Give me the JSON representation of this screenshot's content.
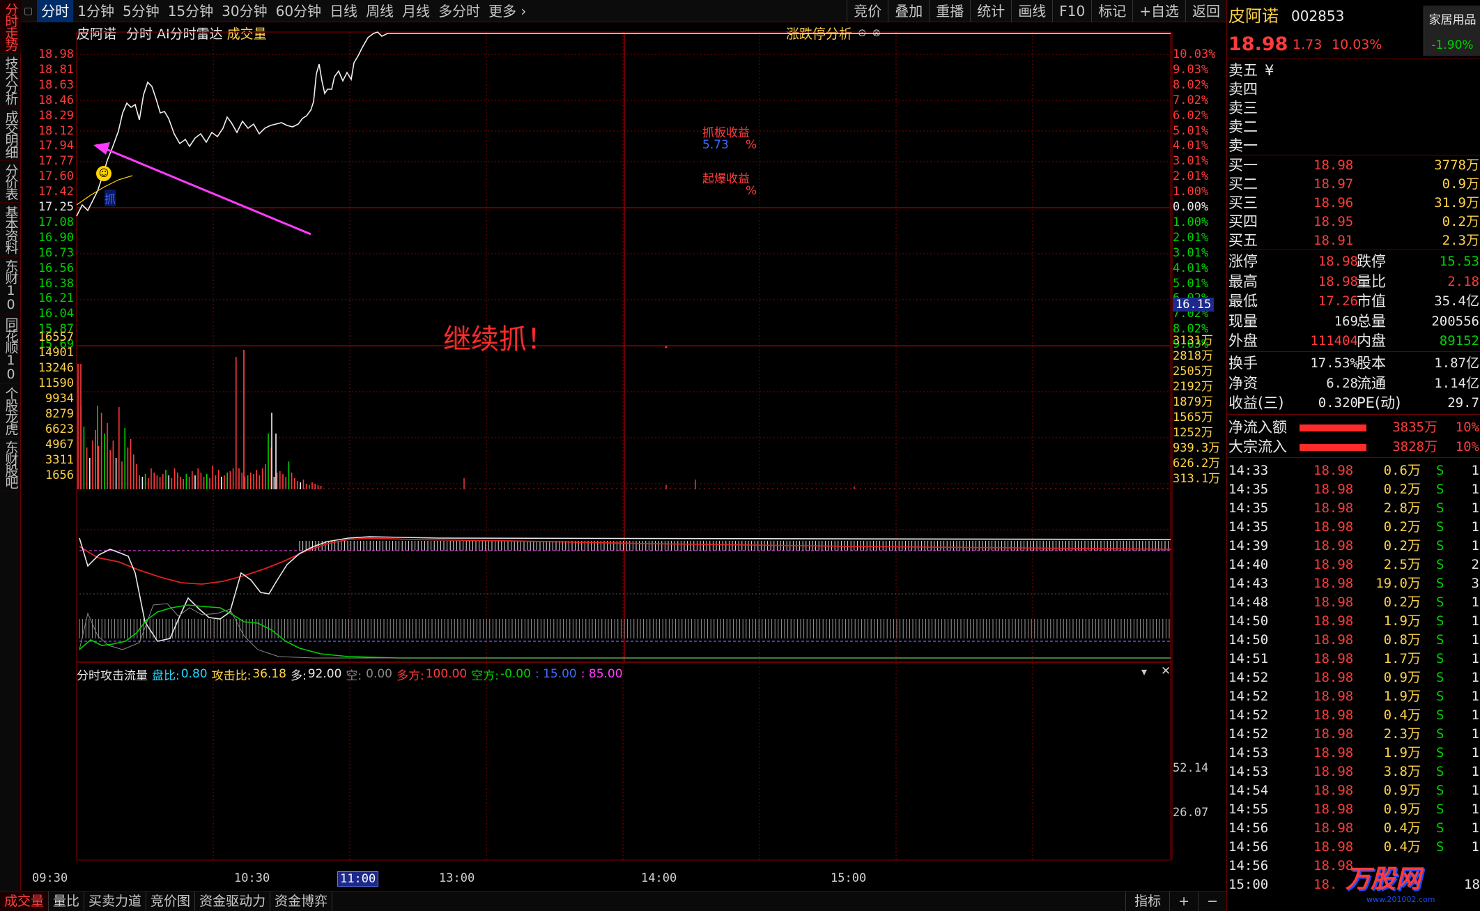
{
  "left_tabs": [
    "分时走势",
    "技术分析",
    "成交明细",
    "分价表",
    "基本资料",
    "东财10",
    "同花顺10",
    "个股龙虎",
    "东财股吧"
  ],
  "toolbar": {
    "left": [
      "分时",
      "1分钟",
      "5分钟",
      "15分钟",
      "30分钟",
      "60分钟",
      "日线",
      "周线",
      "月线",
      "多分时",
      "更多 ›"
    ],
    "right": [
      "竞价",
      "叠加",
      "重播",
      "统计",
      "画线",
      "F10",
      "标记",
      "+自选",
      "返回"
    ]
  },
  "info_bar": {
    "stock": "皮阿诺",
    "mode": "分时",
    "radar": "AI分时雷达",
    "volume": "成交量",
    "analysis": "涨跌停分析"
  },
  "price_axis_left": [
    "18.98",
    "18.81",
    "18.63",
    "18.46",
    "18.29",
    "18.12",
    "17.94",
    "17.77",
    "17.60",
    "17.42",
    "17.25",
    "17.08",
    "16.90",
    "16.73",
    "16.56",
    "16.38",
    "16.21",
    "16.04",
    "15.87",
    "15.69"
  ],
  "price_axis_right": [
    "10.03%",
    "9.03%",
    "8.02%",
    "7.02%",
    "6.02%",
    "5.01%",
    "4.01%",
    "3.01%",
    "2.01%",
    "1.00%",
    "0.00%",
    "1.00%",
    "2.01%",
    "3.01%",
    "4.01%",
    "5.01%",
    "6.02%",
    "7.02%",
    "8.02%",
    "9.03%"
  ],
  "price_axis_marker": "16.15",
  "volume_axis_left": [
    "16557",
    "14901",
    "13246",
    "11590",
    "9934",
    "8279",
    "6623",
    "4967",
    "3311",
    "1656"
  ],
  "volume_axis_right": [
    "3131万",
    "2818万",
    "2505万",
    "2192万",
    "1879万",
    "1565万",
    "1252万",
    "939.3万",
    "626.2万",
    "313.1万"
  ],
  "annotations": {
    "grab_profit": "抓板收益",
    "grab_value": "5.73",
    "grab_pct": "%",
    "blast_profit": "起爆收益",
    "blast_pct": "%",
    "grab_marker": "抓",
    "callout": "继续抓！"
  },
  "indicator": {
    "name": "分时攻击流量",
    "pan_label": "盘比:",
    "pan_value": "0.80",
    "attack_label": "攻击比:",
    "attack_value": "36.18",
    "duo_label": "多:",
    "duo_value": "92.00",
    "kong_label": "空:",
    "kong_value": "0.00",
    "duofang_label": "多方:",
    "duofang_value": "100.00",
    "kongfang_label": "空方:",
    "kongfang_value": "-0.00",
    "v15": ": 15.00",
    "v85": ": 85.00",
    "axis1": "52.14",
    "axis2": "26.07"
  },
  "time_axis": [
    "09:30",
    "10:30",
    "11:00",
    "13:00",
    "14:00",
    "15:00"
  ],
  "bottom_tabs": [
    "成交量",
    "量比",
    "买卖力道",
    "竞价图",
    "资金驱动力",
    "资金博弈"
  ],
  "bottom_right": [
    "指标",
    "+",
    "−"
  ],
  "panel": {
    "name": "皮阿诺",
    "code": "002853",
    "tag": "家居用品",
    "tag_change": "-1.90%",
    "price": "18.98",
    "change": "1.73",
    "change_pct": "10.03%",
    "asks": [
      {
        "label": "卖五",
        "price": "¥",
        "vol": ""
      },
      {
        "label": "卖四",
        "price": "",
        "vol": ""
      },
      {
        "label": "卖三",
        "price": "",
        "vol": ""
      },
      {
        "label": "卖二",
        "price": "",
        "vol": ""
      },
      {
        "label": "卖一",
        "price": "",
        "vol": ""
      }
    ],
    "bids": [
      {
        "label": "买一",
        "price": "18.98",
        "vol": "3778万"
      },
      {
        "label": "买二",
        "price": "18.97",
        "vol": "0.9万"
      },
      {
        "label": "买三",
        "price": "18.96",
        "vol": "31.9万"
      },
      {
        "label": "买四",
        "price": "18.95",
        "vol": "0.2万"
      },
      {
        "label": "买五",
        "price": "18.91",
        "vol": "2.3万"
      }
    ],
    "stats": [
      {
        "l1": "涨停",
        "v1": "18.98",
        "l2": "跌停",
        "v2": "15.53"
      },
      {
        "l1": "最高",
        "v1": "18.98",
        "l2": "量比",
        "v2": "2.18"
      },
      {
        "l1": "最低",
        "v1": "17.26",
        "l2": "市值",
        "v2": "35.4亿"
      },
      {
        "l1": "现量",
        "v1": "169",
        "l2": "总量",
        "v2": "200556"
      },
      {
        "l1": "外盘",
        "v1": "111404",
        "l2": "内盘",
        "v2": "89152"
      }
    ],
    "stats2": [
      {
        "l1": "换手",
        "v1": "17.53%",
        "l2": "股本",
        "v2": "1.87亿"
      },
      {
        "l1": "净资",
        "v1": "6.28",
        "l2": "流通",
        "v2": "1.14亿"
      },
      {
        "l1": "收益(三)",
        "v1": "0.320",
        "l2": "PE(动)",
        "v2": "29.7"
      }
    ],
    "flows": [
      {
        "label": "净流入额",
        "value": "3835万",
        "pct": "10%"
      },
      {
        "label": "大宗流入",
        "value": "3828万",
        "pct": "10%"
      }
    ],
    "ticks": [
      {
        "t": "14:33",
        "p": "18.98",
        "v": "0.6万",
        "s": "S",
        "n": "1"
      },
      {
        "t": "14:35",
        "p": "18.98",
        "v": "0.2万",
        "s": "S",
        "n": "1"
      },
      {
        "t": "14:35",
        "p": "18.98",
        "v": "2.8万",
        "s": "S",
        "n": "1"
      },
      {
        "t": "14:35",
        "p": "18.98",
        "v": "0.2万",
        "s": "S",
        "n": "1"
      },
      {
        "t": "14:39",
        "p": "18.98",
        "v": "0.2万",
        "s": "S",
        "n": "1"
      },
      {
        "t": "14:40",
        "p": "18.98",
        "v": "2.5万",
        "s": "S",
        "n": "2"
      },
      {
        "t": "14:43",
        "p": "18.98",
        "v": "19.0万",
        "s": "S",
        "n": "3"
      },
      {
        "t": "14:48",
        "p": "18.98",
        "v": "0.2万",
        "s": "S",
        "n": "1"
      },
      {
        "t": "14:50",
        "p": "18.98",
        "v": "1.9万",
        "s": "S",
        "n": "1"
      },
      {
        "t": "14:50",
        "p": "18.98",
        "v": "0.8万",
        "s": "S",
        "n": "1"
      },
      {
        "t": "14:51",
        "p": "18.98",
        "v": "1.7万",
        "s": "S",
        "n": "1"
      },
      {
        "t": "14:52",
        "p": "18.98",
        "v": "0.9万",
        "s": "S",
        "n": "1"
      },
      {
        "t": "14:52",
        "p": "18.98",
        "v": "1.9万",
        "s": "S",
        "n": "1"
      },
      {
        "t": "14:52",
        "p": "18.98",
        "v": "0.4万",
        "s": "S",
        "n": "1"
      },
      {
        "t": "14:52",
        "p": "18.98",
        "v": "2.3万",
        "s": "S",
        "n": "1"
      },
      {
        "t": "14:53",
        "p": "18.98",
        "v": "1.9万",
        "s": "S",
        "n": "1"
      },
      {
        "t": "14:53",
        "p": "18.98",
        "v": "3.8万",
        "s": "S",
        "n": "1"
      },
      {
        "t": "14:54",
        "p": "18.98",
        "v": "0.9万",
        "s": "S",
        "n": "1"
      },
      {
        "t": "14:55",
        "p": "18.98",
        "v": "0.9万",
        "s": "S",
        "n": "1"
      },
      {
        "t": "14:56",
        "p": "18.98",
        "v": "0.4万",
        "s": "S",
        "n": "1"
      },
      {
        "t": "14:56",
        "p": "18.98",
        "v": "0.4万",
        "s": "S",
        "n": "1"
      },
      {
        "t": "14:56",
        "p": "18.98",
        "v": "",
        "s": "",
        "n": ""
      },
      {
        "t": "15:00",
        "p": "18.",
        "v": "",
        "s": "",
        "n": "18"
      }
    ],
    "watermark": "万股网",
    "watermark_url": "www.201002.com"
  },
  "colors": {
    "up": "#ff3b3b",
    "down": "#00d200",
    "grid": "#8a0000",
    "accent": "#ff3cff"
  }
}
